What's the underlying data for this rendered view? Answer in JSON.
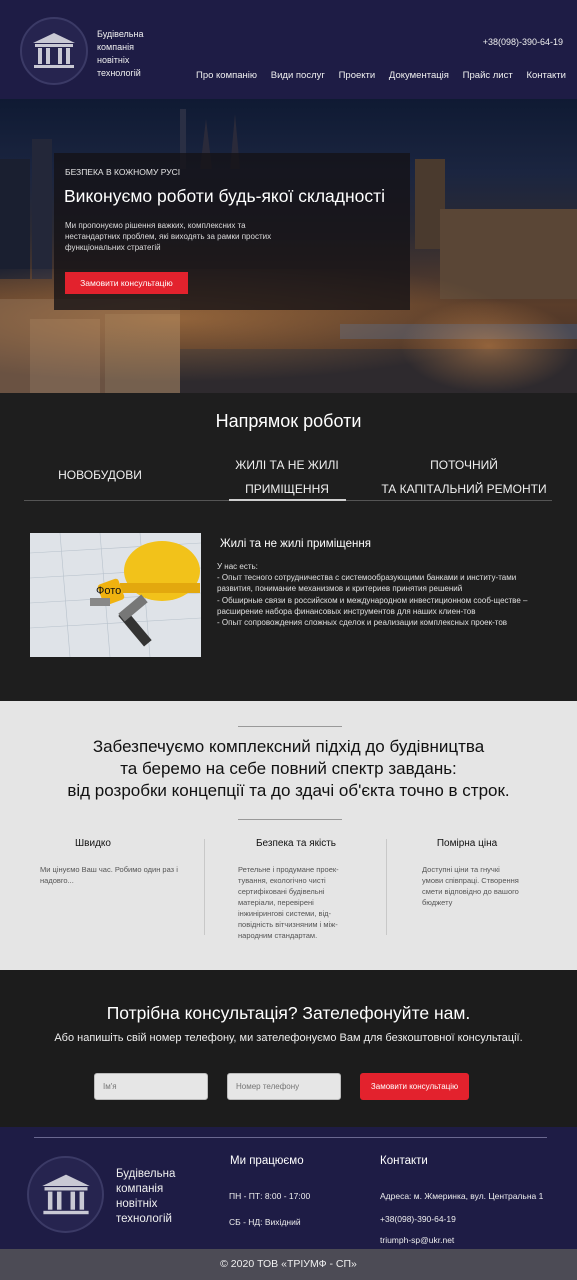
{
  "header": {
    "logo_lines": [
      "Будівельна",
      "компанія",
      "новітніх",
      "технологій"
    ],
    "phone": "+38(098)-390-64-19",
    "nav": [
      "Про компанію",
      "Види послуг",
      "Проекти",
      "Документація",
      "Прайс лист",
      "Контакти"
    ]
  },
  "hero": {
    "kicker": "БЕЗПЕКА В КОЖНОМУ РУСІ",
    "title": "Виконуємо роботи будь-якої складності",
    "description": "Ми пропонуємо рішення важких, комплексних та нестандартних проблем, які виходять за рамки простих функціональних стратегій",
    "button": "Замовити консультацію"
  },
  "direction": {
    "title": "Напрямок роботи",
    "tabs": [
      "НОВОБУДОВИ",
      "ЖИЛІ ТА НЕ ЖИЛІ\nПРИМІЩЕННЯ",
      "ПОТОЧНИЙ\nТА КАПІТАЛЬНИЙ РЕМОНТИ"
    ],
    "photo_label": "Фото",
    "subtitle": "Жилі та не жилі приміщення",
    "text_intro": "У нас есть:",
    "text_items": [
      "- Опыт тесного сотрудничества с системообразующими банками и институ-тами развития, понимание механизмов и критериев принятия решений",
      "- Обширные связи в российском и международном инвестиционном сооб-ществе – расширение набора финансовых инструментов для наших клиен-тов",
      "- Опыт сопровождения сложных сделок и реализации комплексных проек-тов"
    ]
  },
  "approach": {
    "title_lines": [
      "Забезпечуємо комплексний підхід до будівництва",
      "та беремо на себе повний спектр завдань:",
      "від розробки концепції та до здачі об'єкта точно в строк."
    ],
    "features": [
      {
        "title": "Швидко",
        "text": "Ми цінуємо Ваш час. Робимо один раз і надовго..."
      },
      {
        "title": "Безпека та якість",
        "text": "Ретельне і продумане проек-тування, екологічно чисті сертифіковані будівельні матеріали, перевірені інжинірингові системи, від-повідність вітчизняним і між-народним стандартам."
      },
      {
        "title": "Помірна ціна",
        "text": "Доступні ціни та гнучкі умови співпраці. Створення смети відповідно до вашого бюджету"
      }
    ]
  },
  "consult": {
    "title": "Потрібна консультація? Зателефонуйте нам.",
    "subtitle": "Або напишіть свій номер телефону, ми зателефонуємо Вам для безкоштовної консультації.",
    "name_placeholder": "Ім'я",
    "phone_placeholder": "Номер телефону",
    "button": "Замовити консультацію"
  },
  "footer": {
    "logo_lines": [
      "Будівельна",
      "компанія",
      "новітніх",
      "технологій"
    ],
    "work_title": "Ми працюємо",
    "work_hours": [
      "ПН - ПТ: 8:00 - 17:00",
      "СБ - НД: Вихідний"
    ],
    "contacts_title": "Контакти",
    "address": "Адреса: м. Жмеринка, вул. Центральна 1",
    "phone": "+38(098)-390-64-19",
    "email": "triumph-sp@ukr.net",
    "copyright": "© 2020 ТОВ «ТРІУМФ - СП»"
  },
  "colors": {
    "header_bg": "#1e1c45",
    "accent_red": "#e3222d",
    "dark_bg": "#1c1c1c",
    "light_bg": "#e5e5e5",
    "copyright_bg": "#4c4b55"
  }
}
